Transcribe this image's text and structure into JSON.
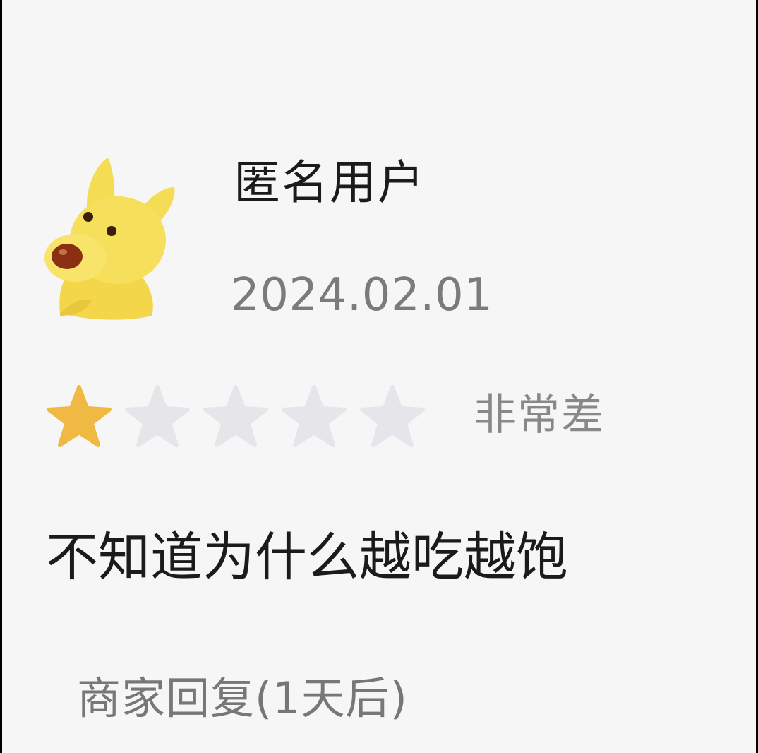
{
  "review": {
    "username": "匿名用户",
    "date": "2024.02.01",
    "rating": 1,
    "rating_max": 5,
    "rating_label": "非常差",
    "text": "不知道为什么越吃越饱",
    "merchant_reply_label": "商家回复(1天后)"
  },
  "avatar": {
    "icon": "yellow-dog-avatar-icon"
  },
  "colors": {
    "star_filled": "#f0b944",
    "star_empty": "#e6e6ea",
    "text_primary": "#1b1b1b",
    "text_secondary": "#7b7b7b"
  }
}
